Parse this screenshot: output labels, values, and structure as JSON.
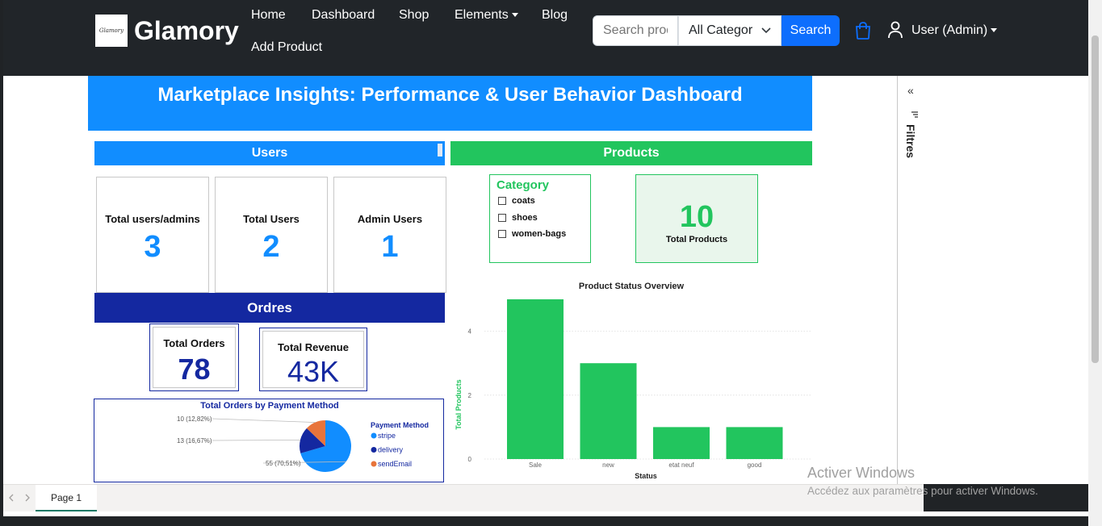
{
  "navbar": {
    "brand": "Glamory",
    "logo_text": "Glamory",
    "links": [
      "Home",
      "Dashboard",
      "Shop",
      "Elements",
      "Blog",
      "Add Product"
    ],
    "search_placeholder": "Search products",
    "category_selected": "All Categor",
    "search_button": "Search",
    "user_label": "User (Admin)"
  },
  "report": {
    "title": "Marketplace Insights: Performance & User Behavior Dashboard",
    "users_header": "Users",
    "products_header": "Products",
    "orders_header": "Ordres",
    "user_cards": [
      {
        "label": "Total users/admins",
        "value": "3"
      },
      {
        "label": "Total Users",
        "value": "2"
      },
      {
        "label": "Admin Users",
        "value": "1"
      }
    ],
    "order_cards": [
      {
        "label": "Total Orders",
        "value": "78"
      },
      {
        "label": "Total Revenue",
        "value": "43K"
      }
    ],
    "category_slicer": {
      "title": "Category",
      "items": [
        "coats",
        "shoes",
        "women-bags"
      ]
    },
    "total_products": {
      "value": "10",
      "label": "Total Products"
    }
  },
  "filters": {
    "label": "Filtres",
    "collapse": "«"
  },
  "page_tabs": {
    "active": "Page 1"
  },
  "watermark": {
    "title": "Activer Windows",
    "subtitle": "Accédez aux paramètres pour activer Windows."
  },
  "colors": {
    "blue": "#118dff",
    "green": "#22c55e",
    "navy": "#1428a0",
    "orange": "#e8743b"
  },
  "chart_data": [
    {
      "type": "pie",
      "title": "Total Orders by Payment Method",
      "legend_title": "Payment Method",
      "legend_position": "right",
      "categories": [
        "stripe",
        "delivery",
        "sendEmail"
      ],
      "values": [
        55,
        13,
        10
      ],
      "labels": [
        "55 (70,51%)",
        "13 (16,67%)",
        "10 (12,82%)"
      ],
      "colors": [
        "#118dff",
        "#1428a0",
        "#e8743b"
      ]
    },
    {
      "type": "bar",
      "title": "Product Status Overview",
      "xlabel": "Status",
      "ylabel": "Total Products",
      "categories": [
        "Sale",
        "new",
        "etat neuf",
        "good"
      ],
      "values": [
        5,
        3,
        1,
        1
      ],
      "ylim": [
        0,
        5
      ],
      "yticks": [
        0,
        2,
        4
      ],
      "grid": true,
      "color": "#22c55e"
    }
  ]
}
